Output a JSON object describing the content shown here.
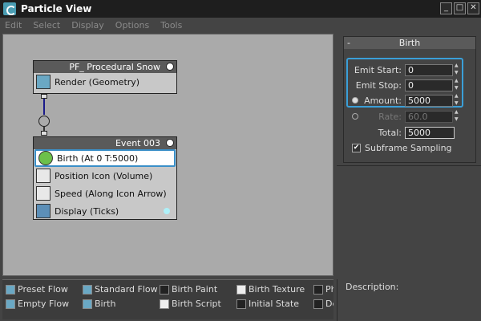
{
  "window": {
    "title": "Particle View",
    "controls": [
      "_",
      "□",
      "✕"
    ]
  },
  "menu": [
    "Edit",
    "Select",
    "Display",
    "Options",
    "Tools"
  ],
  "canvas": {
    "flow_node": {
      "title": "PF_ Procedural Snow",
      "operator": "Render (Geometry)"
    },
    "event_node": {
      "title": "Event 003",
      "operators": [
        "Birth  (At 0 T:5000)",
        "Position Icon (Volume)",
        "Speed  (Along Icon Arrow)",
        "Display  (Ticks)"
      ]
    }
  },
  "rollout": {
    "title": "Birth",
    "collapse": "-",
    "emit_start_label": "Emit Start:",
    "emit_start_value": "0",
    "emit_stop_label": "Emit Stop:",
    "emit_stop_value": "0",
    "amount_label": "Amount:",
    "amount_value": "5000",
    "rate_label": "Rate:",
    "rate_value": "60.0",
    "total_label": "Total:",
    "total_value": "5000",
    "subframe_label": "Subframe Sampling",
    "subframe_checked": "✔"
  },
  "depot": {
    "col1": [
      "Preset Flow",
      "Empty Flow"
    ],
    "col2": [
      "Standard Flow",
      "Birth"
    ],
    "col3": [
      "Birth Paint",
      "Birth Script"
    ],
    "col4": [
      "Birth Texture",
      "Initial State"
    ],
    "col5": [
      "Ph",
      "De"
    ]
  },
  "description": {
    "label": "Description:"
  },
  "colors": {
    "accent": "#3a9fd8",
    "canvas": "#aaaaaa"
  }
}
